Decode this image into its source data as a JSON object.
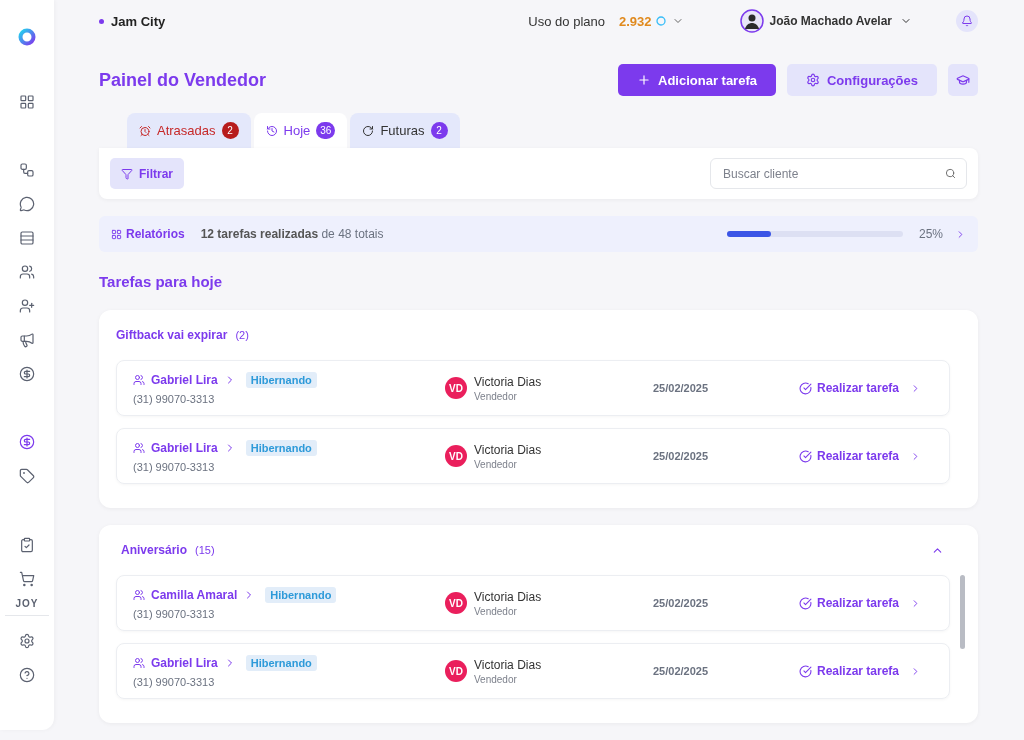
{
  "sidebar": {
    "items": [
      {
        "kind": "icon",
        "selected": false
      },
      {
        "kind": "icon",
        "selected": false
      },
      {
        "kind": "icon",
        "selected": false
      },
      {
        "kind": "icon",
        "selected": false
      },
      {
        "kind": "icon",
        "selected": false
      },
      {
        "kind": "icon",
        "selected": false
      },
      {
        "kind": "icon",
        "selected": false
      },
      {
        "kind": "icon",
        "selected": false
      },
      {
        "kind": "icon",
        "selected": true
      },
      {
        "kind": "icon",
        "selected": false
      },
      {
        "kind": "icon",
        "selected": false
      },
      {
        "kind": "icon",
        "selected": false
      },
      {
        "kind": "text",
        "label": "JOY",
        "selected": false
      },
      {
        "kind": "icon",
        "selected": false
      },
      {
        "kind": "icon",
        "selected": false
      }
    ]
  },
  "workspace": {
    "name": "Jam City"
  },
  "plan_usage": {
    "label": "Uso do plano",
    "value": "2.932"
  },
  "user": {
    "name": "João Machado Avelar"
  },
  "page_title": "Painel do Vendedor",
  "actions": [
    {
      "kind": "primary",
      "label": "Adicionar tarefa"
    },
    {
      "kind": "secondary",
      "label": "Configurações"
    },
    {
      "kind": "icon"
    }
  ],
  "tabs": [
    {
      "kind": "overdue",
      "label": "Atrasadas",
      "count": "2",
      "selected": false
    },
    {
      "kind": "today",
      "label": "Hoje",
      "count": "36",
      "selected": true
    },
    {
      "kind": "future",
      "label": "Futuras",
      "count": "2",
      "selected": false
    }
  ],
  "filter": {
    "label": "Filtrar"
  },
  "search": {
    "placeholder": "Buscar cliente"
  },
  "report": {
    "link": "Relatórios",
    "summary": "**12 tarefas realizadas** de 48 totais",
    "level": 0.25,
    "reading": "25%"
  },
  "section_title": "Tarefas para hoje",
  "groups": [
    {
      "kind": "fixed",
      "title": "Giftback vai expirar",
      "count": "(2)",
      "expanded": true,
      "rows": [
        {
          "client": "Gabriel Lira",
          "status": "Hibernando",
          "phone": "(31) 99070-3313",
          "initials": "VD",
          "seller": "Victoria Dias",
          "role": "Vendedor",
          "date": "25/02/2025",
          "action": "Realizar tarefa"
        },
        {
          "client": "Gabriel Lira",
          "status": "Hibernando",
          "phone": "(31) 99070-3313",
          "initials": "VD",
          "seller": "Victoria Dias",
          "role": "Vendedor",
          "date": "25/02/2025",
          "action": "Realizar tarefa"
        }
      ]
    },
    {
      "kind": "collapsible",
      "title": "Aniversário",
      "count": "(15)",
      "expanded": true,
      "rows": [
        {
          "client": "Camilla Amaral",
          "status": "Hibernando",
          "phone": "(31) 99070-3313",
          "initials": "VD",
          "seller": "Victoria Dias",
          "role": "Vendedor",
          "date": "25/02/2025",
          "action": "Realizar tarefa"
        },
        {
          "client": "Gabriel Lira",
          "status": "Hibernando",
          "phone": "(31) 99070-3313",
          "initials": "VD",
          "seller": "Victoria Dias",
          "role": "Vendedor",
          "date": "25/02/2025",
          "action": "Realizar tarefa"
        }
      ]
    }
  ]
}
